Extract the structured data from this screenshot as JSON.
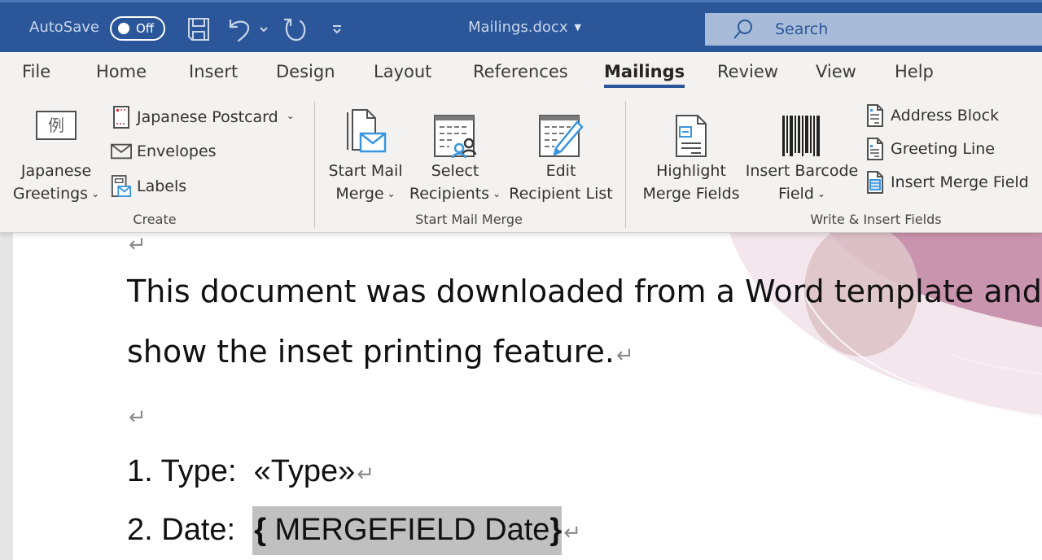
{
  "titlebar": {
    "autosave_label": "AutoSave",
    "autosave_state": "Off",
    "document_title": "Mailings.docx",
    "search_placeholder": "Search",
    "quick_access": [
      "save-icon",
      "undo-icon",
      "undo-dropdown-icon",
      "redo-icon",
      "customize-quick-access-icon"
    ]
  },
  "tabs": [
    {
      "label": "File"
    },
    {
      "label": "Home"
    },
    {
      "label": "Insert"
    },
    {
      "label": "Design"
    },
    {
      "label": "Layout"
    },
    {
      "label": "References"
    },
    {
      "label": "Mailings",
      "active": true
    },
    {
      "label": "Review"
    },
    {
      "label": "View"
    },
    {
      "label": "Help"
    }
  ],
  "ribbon": {
    "create": {
      "label": "Create",
      "japanese_greetings": {
        "line1": "Japanese",
        "line2": "Greetings",
        "icon_glyph": "例"
      },
      "japanese_postcard": "Japanese Postcard",
      "envelopes": "Envelopes",
      "labels": "Labels"
    },
    "start_mail_merge": {
      "label": "Start Mail Merge",
      "start": {
        "line1": "Start Mail",
        "line2": "Merge"
      },
      "select": {
        "line1": "Select",
        "line2": "Recipients"
      },
      "edit": {
        "line1": "Edit",
        "line2": "Recipient List"
      }
    },
    "write_insert": {
      "label": "Write & Insert Fields",
      "highlight": {
        "line1": "Highlight",
        "line2": "Merge Fields"
      },
      "barcode": {
        "line1": "Insert Barcode",
        "line2": "Field"
      },
      "address_block": "Address Block",
      "greeting_line": "Greeting Line",
      "insert_merge_field": "Insert Merge Field"
    }
  },
  "document": {
    "para1_line1": "This document was downloaded from a Word template and",
    "para1_line2": "show the inset printing feature.",
    "pilcrow": "↵",
    "item1_label": "1. Type:",
    "item1_value": "«Type»",
    "item2_label": "2. Date:",
    "item2_open": "{",
    "item2_field": " MERGEFIELD Date",
    "item2_close": "}"
  },
  "colors": {
    "titlebar": "#2b579a",
    "search_box": "#a8bcd9",
    "ribbon": "#f3f2f1",
    "accent_blue": "#2b579a",
    "icon_blue": "#3a96dd",
    "field_shading": "#c0c0c0",
    "decor_pink": "#c994ad"
  }
}
